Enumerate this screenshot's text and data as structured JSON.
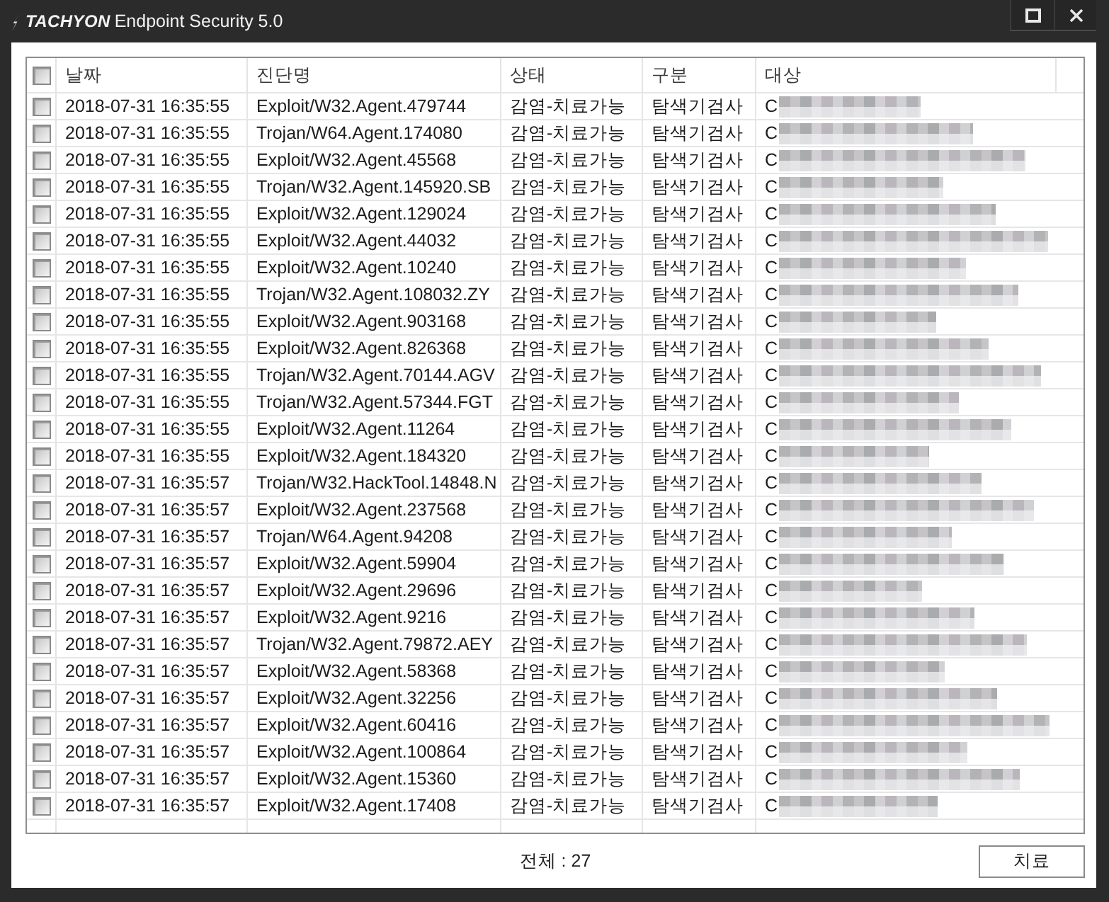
{
  "window": {
    "logo_text": "TACHYON",
    "title": "Endpoint Security 5.0",
    "controls": [
      {
        "kind": "maximize"
      },
      {
        "kind": "close"
      }
    ]
  },
  "table": {
    "select_all": {
      "checked": false
    },
    "columns": [
      "날짜",
      "진단명",
      "상태",
      "구분",
      "대상"
    ],
    "rows": [
      {
        "checked": false,
        "date": "2018-07-31 16:35:55",
        "detection": "Exploit/W32.Agent.479744",
        "status": "감염-치료가능",
        "category": "탐색기검사",
        "target": "C",
        "target_blurred": true
      },
      {
        "checked": false,
        "date": "2018-07-31 16:35:55",
        "detection": "Trojan/W64.Agent.174080",
        "status": "감염-치료가능",
        "category": "탐색기검사",
        "target": "C",
        "target_blurred": true
      },
      {
        "checked": false,
        "date": "2018-07-31 16:35:55",
        "detection": "Exploit/W32.Agent.45568",
        "status": "감염-치료가능",
        "category": "탐색기검사",
        "target": "C",
        "target_blurred": true
      },
      {
        "checked": false,
        "date": "2018-07-31 16:35:55",
        "detection": "Trojan/W32.Agent.145920.SB",
        "status": "감염-치료가능",
        "category": "탐색기검사",
        "target": "C",
        "target_blurred": true
      },
      {
        "checked": false,
        "date": "2018-07-31 16:35:55",
        "detection": "Exploit/W32.Agent.129024",
        "status": "감염-치료가능",
        "category": "탐색기검사",
        "target": "C",
        "target_blurred": true
      },
      {
        "checked": false,
        "date": "2018-07-31 16:35:55",
        "detection": "Exploit/W32.Agent.44032",
        "status": "감염-치료가능",
        "category": "탐색기검사",
        "target": "C",
        "target_blurred": true
      },
      {
        "checked": false,
        "date": "2018-07-31 16:35:55",
        "detection": "Exploit/W32.Agent.10240",
        "status": "감염-치료가능",
        "category": "탐색기검사",
        "target": "C",
        "target_blurred": true
      },
      {
        "checked": false,
        "date": "2018-07-31 16:35:55",
        "detection": "Trojan/W32.Agent.108032.ZY",
        "status": "감염-치료가능",
        "category": "탐색기검사",
        "target": "C",
        "target_blurred": true
      },
      {
        "checked": false,
        "date": "2018-07-31 16:35:55",
        "detection": "Exploit/W32.Agent.903168",
        "status": "감염-치료가능",
        "category": "탐색기검사",
        "target": "C",
        "target_blurred": true
      },
      {
        "checked": false,
        "date": "2018-07-31 16:35:55",
        "detection": "Exploit/W32.Agent.826368",
        "status": "감염-치료가능",
        "category": "탐색기검사",
        "target": "C",
        "target_blurred": true
      },
      {
        "checked": false,
        "date": "2018-07-31 16:35:55",
        "detection": "Trojan/W32.Agent.70144.AGV",
        "status": "감염-치료가능",
        "category": "탐색기검사",
        "target": "C",
        "target_blurred": true
      },
      {
        "checked": false,
        "date": "2018-07-31 16:35:55",
        "detection": "Trojan/W32.Agent.57344.FGT",
        "status": "감염-치료가능",
        "category": "탐색기검사",
        "target": "C",
        "target_blurred": true
      },
      {
        "checked": false,
        "date": "2018-07-31 16:35:55",
        "detection": "Exploit/W32.Agent.11264",
        "status": "감염-치료가능",
        "category": "탐색기검사",
        "target": "C",
        "target_blurred": true
      },
      {
        "checked": false,
        "date": "2018-07-31 16:35:55",
        "detection": "Exploit/W32.Agent.184320",
        "status": "감염-치료가능",
        "category": "탐색기검사",
        "target": "C",
        "target_blurred": true
      },
      {
        "checked": false,
        "date": "2018-07-31 16:35:57",
        "detection": "Trojan/W32.HackTool.14848.N",
        "status": "감염-치료가능",
        "category": "탐색기검사",
        "target": "C",
        "target_blurred": true
      },
      {
        "checked": false,
        "date": "2018-07-31 16:35:57",
        "detection": "Exploit/W32.Agent.237568",
        "status": "감염-치료가능",
        "category": "탐색기검사",
        "target": "C",
        "target_blurred": true
      },
      {
        "checked": false,
        "date": "2018-07-31 16:35:57",
        "detection": "Trojan/W64.Agent.94208",
        "status": "감염-치료가능",
        "category": "탐색기검사",
        "target": "C",
        "target_blurred": true
      },
      {
        "checked": false,
        "date": "2018-07-31 16:35:57",
        "detection": "Exploit/W32.Agent.59904",
        "status": "감염-치료가능",
        "category": "탐색기검사",
        "target": "C",
        "target_blurred": true
      },
      {
        "checked": false,
        "date": "2018-07-31 16:35:57",
        "detection": "Exploit/W32.Agent.29696",
        "status": "감염-치료가능",
        "category": "탐색기검사",
        "target": "C",
        "target_blurred": true
      },
      {
        "checked": false,
        "date": "2018-07-31 16:35:57",
        "detection": "Exploit/W32.Agent.9216",
        "status": "감염-치료가능",
        "category": "탐색기검사",
        "target": "C",
        "target_blurred": true
      },
      {
        "checked": false,
        "date": "2018-07-31 16:35:57",
        "detection": "Trojan/W32.Agent.79872.AEY",
        "status": "감염-치료가능",
        "category": "탐색기검사",
        "target": "C",
        "target_blurred": true
      },
      {
        "checked": false,
        "date": "2018-07-31 16:35:57",
        "detection": "Exploit/W32.Agent.58368",
        "status": "감염-치료가능",
        "category": "탐색기검사",
        "target": "C",
        "target_blurred": true
      },
      {
        "checked": false,
        "date": "2018-07-31 16:35:57",
        "detection": "Exploit/W32.Agent.32256",
        "status": "감염-치료가능",
        "category": "탐색기검사",
        "target": "C",
        "target_blurred": true
      },
      {
        "checked": false,
        "date": "2018-07-31 16:35:57",
        "detection": "Exploit/W32.Agent.60416",
        "status": "감염-치료가능",
        "category": "탐색기검사",
        "target": "C",
        "target_blurred": true
      },
      {
        "checked": false,
        "date": "2018-07-31 16:35:57",
        "detection": "Exploit/W32.Agent.100864",
        "status": "감염-치료가능",
        "category": "탐색기검사",
        "target": "C",
        "target_blurred": true
      },
      {
        "checked": false,
        "date": "2018-07-31 16:35:57",
        "detection": "Exploit/W32.Agent.15360",
        "status": "감염-치료가능",
        "category": "탐색기검사",
        "target": "C",
        "target_blurred": true
      },
      {
        "checked": false,
        "date": "2018-07-31 16:35:57",
        "detection": "Exploit/W32.Agent.17408",
        "status": "감염-치료가능",
        "category": "탐색기검사",
        "target": "C",
        "target_blurred": true
      }
    ]
  },
  "footer": {
    "total": "전체 : 27",
    "button": "치료"
  }
}
